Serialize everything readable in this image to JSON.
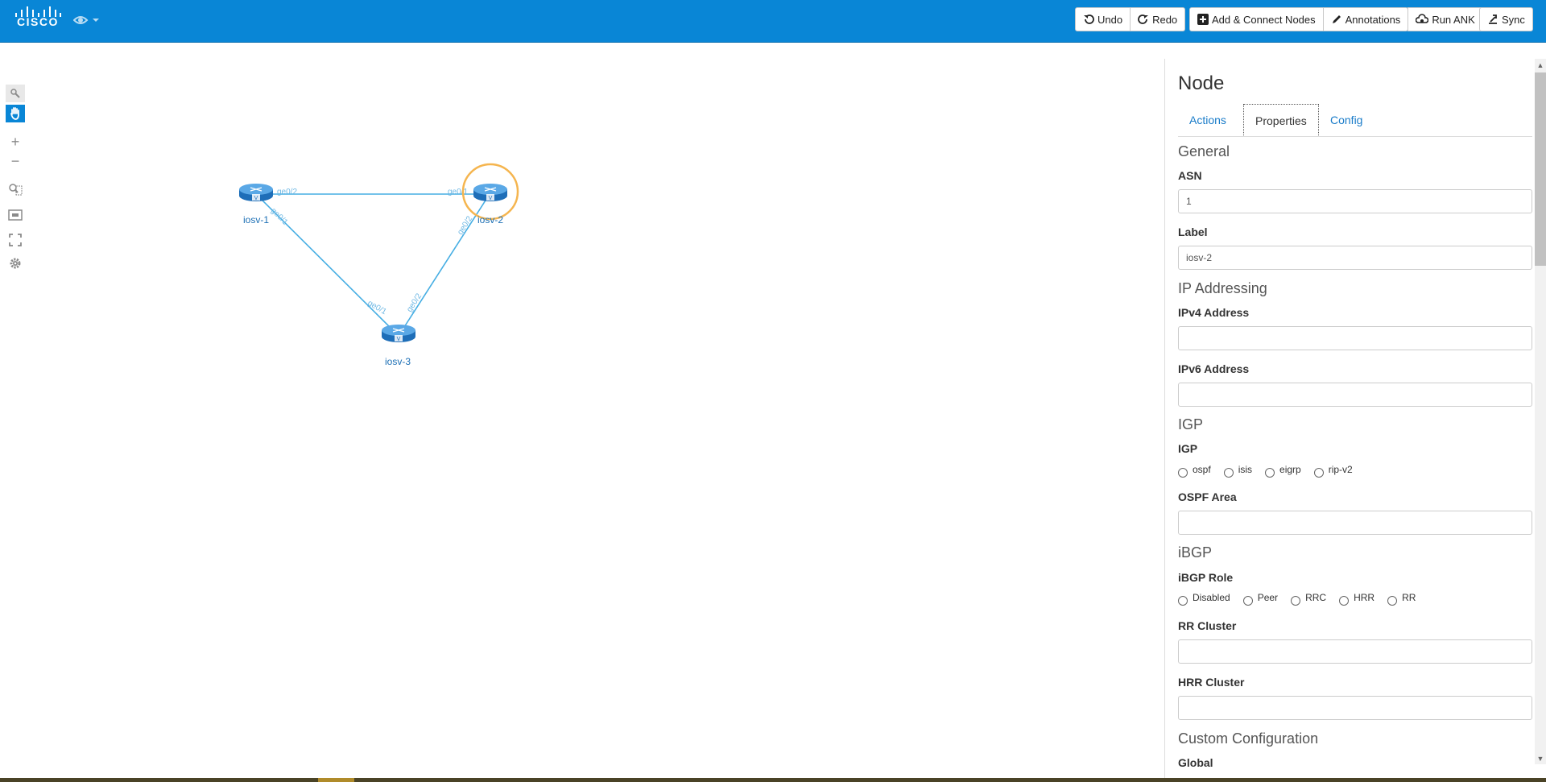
{
  "header": {
    "brand": "CISCO",
    "toolbar": [
      {
        "label": "Undo",
        "icon": "undo-icon"
      },
      {
        "label": "Redo",
        "icon": "redo-icon"
      },
      {
        "label": "Add & Connect Nodes",
        "icon": "plus-square-icon"
      },
      {
        "label": "Annotations",
        "icon": "pencil-icon"
      },
      {
        "label": "Run ANK",
        "icon": "cloud-gear-icon"
      },
      {
        "label": "Sync",
        "icon": "sync-icon"
      }
    ]
  },
  "left_tools": [
    "select-icon",
    "pan-hand-icon",
    "zoom-in-icon",
    "zoom-out-icon",
    "zoom-selection-icon",
    "fit-to-screen-icon",
    "expand-icon",
    "settings-gear-icon"
  ],
  "topology": {
    "nodes": [
      {
        "label": "iosv-1"
      },
      {
        "label": "iosv-2",
        "selected": true
      },
      {
        "label": "iosv-3"
      }
    ],
    "links": [
      {
        "a": "iosv-1",
        "a_port": "ge0/2",
        "b": "iosv-2",
        "b_port": "ge0/1"
      },
      {
        "a": "iosv-1",
        "a_port": "ge0/1",
        "b": "iosv-3",
        "b_port": "ge0/1"
      },
      {
        "a": "iosv-2",
        "a_port": "ge0/2",
        "b": "iosv-3",
        "b_port": "ge0/2"
      }
    ],
    "selection_color": "#f5b54f",
    "link_color": "#46aee3"
  },
  "panel": {
    "title": "Node",
    "tabs": [
      "Actions",
      "Properties",
      "Config"
    ],
    "active_tab": "Properties",
    "sections": {
      "general": "General",
      "ip": "IP Addressing",
      "igp": "IGP",
      "ibgp": "iBGP",
      "custom": "Custom Configuration"
    },
    "fields": {
      "asn_label": "ASN",
      "asn_value": "1",
      "label_label": "Label",
      "label_value": "iosv-2",
      "ipv4_label": "IPv4 Address",
      "ipv4_value": "",
      "ipv6_label": "IPv6 Address",
      "ipv6_value": "",
      "igp_label": "IGP",
      "igp_options": [
        "ospf",
        "isis",
        "eigrp",
        "rip-v2"
      ],
      "ospf_area_label": "OSPF Area",
      "ospf_area_value": "",
      "ibgp_role_label": "iBGP Role",
      "ibgp_role_options": [
        "Disabled",
        "Peer",
        "RRC",
        "HRR",
        "RR"
      ],
      "rr_cluster_label": "RR Cluster",
      "rr_cluster_value": "",
      "hrr_cluster_label": "HRR Cluster",
      "hrr_cluster_value": "",
      "global_label": "Global"
    }
  }
}
